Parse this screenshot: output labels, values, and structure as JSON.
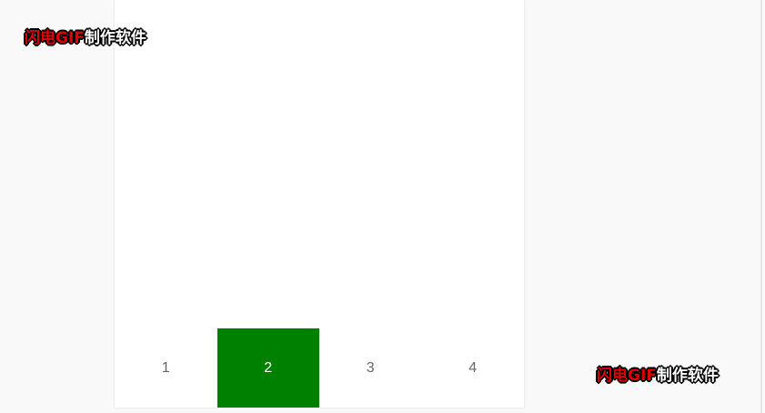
{
  "tabbar": {
    "tabs": [
      {
        "label": "1",
        "active": false
      },
      {
        "label": "2",
        "active": true
      },
      {
        "label": "3",
        "active": false
      },
      {
        "label": "4",
        "active": false
      }
    ],
    "active_color": "#008000",
    "inactive_text_color": "#666666"
  },
  "watermark": {
    "brand": "闪电GIF",
    "suffix": "制作软件",
    "brand_color": "#e00000",
    "suffix_color": "#ffffff"
  }
}
